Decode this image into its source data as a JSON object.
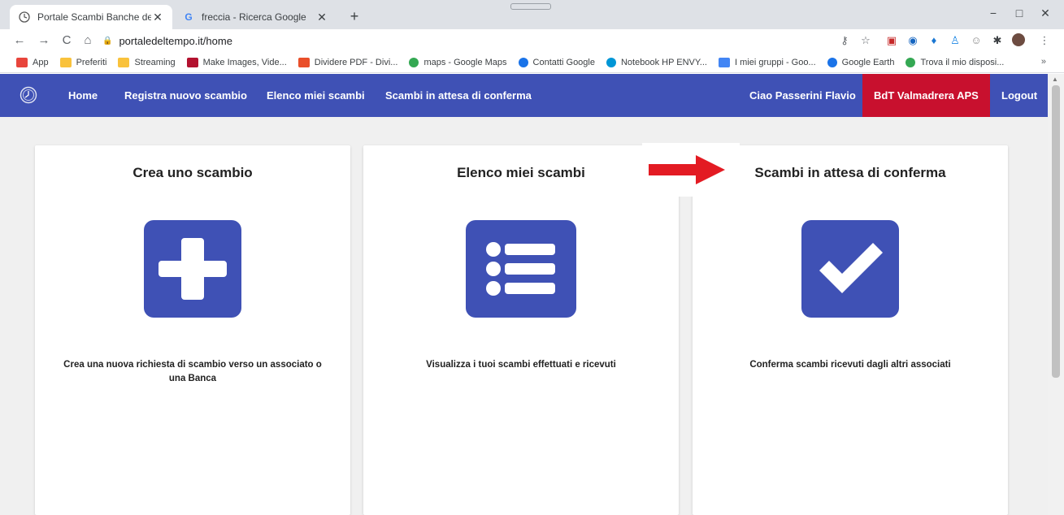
{
  "browser": {
    "tabs": [
      {
        "label": "Portale Scambi Banche del Temp",
        "active": true
      },
      {
        "label": "freccia - Ricerca Google",
        "active": false
      }
    ],
    "new_tab_label": "+",
    "window_controls": {
      "minimize": "−",
      "maximize": "□",
      "close": "✕"
    },
    "nav": {
      "back": "←",
      "forward": "→",
      "reload": "C",
      "home": "⌂"
    },
    "url": "portaledeltempo.it/home",
    "bookmarks": [
      {
        "label": "App",
        "icon": "apps-grid-icon",
        "color": "#e8453c"
      },
      {
        "label": "Preferiti",
        "icon": "folder-icon",
        "color": "#f9c23c"
      },
      {
        "label": "Streaming",
        "icon": "folder-icon",
        "color": "#f9c23c"
      },
      {
        "label": "Make Images, Vide...",
        "icon": "make-icon",
        "color": "#b3122f"
      },
      {
        "label": "Dividere PDF - Divi...",
        "icon": "pdf-icon",
        "color": "#e94f2a"
      },
      {
        "label": "maps - Google Maps",
        "icon": "maps-pin-icon",
        "color": "#34a853"
      },
      {
        "label": "Contatti Google",
        "icon": "contacts-icon",
        "color": "#1a73e8"
      },
      {
        "label": "Notebook HP ENVY...",
        "icon": "hp-icon",
        "color": "#0096d6"
      },
      {
        "label": "I miei gruppi - Goo...",
        "icon": "groups-icon",
        "color": "#4285f4"
      },
      {
        "label": "Google Earth",
        "icon": "earth-icon",
        "color": "#1a73e8"
      },
      {
        "label": "Trova il mio disposi...",
        "icon": "find-device-icon",
        "color": "#34a853"
      }
    ],
    "bookmarks_more": "»"
  },
  "site": {
    "nav": {
      "home": "Home",
      "register": "Registra nuovo scambio",
      "list": "Elenco miei scambi",
      "pending": "Scambi in attesa di conferma",
      "greeting": "Ciao Passerini Flavio",
      "bank": "BdT Valmadrera APS",
      "logout": "Logout"
    },
    "colors": {
      "primary": "#3f51b5",
      "bank": "#c8102e",
      "arrow": "#e31b23"
    },
    "cards": [
      {
        "title": "Crea uno scambio",
        "icon": "plus-icon",
        "description": "Crea una nuova richiesta di scambio verso un associato o una Banca"
      },
      {
        "title": "Elenco miei scambi",
        "icon": "list-icon",
        "description": "Visualizza i tuoi scambi effettuati e ricevuti"
      },
      {
        "title": "Scambi in attesa di conferma",
        "icon": "checkmark-icon",
        "description": "Conferma scambi ricevuti dagli altri associati"
      }
    ]
  }
}
